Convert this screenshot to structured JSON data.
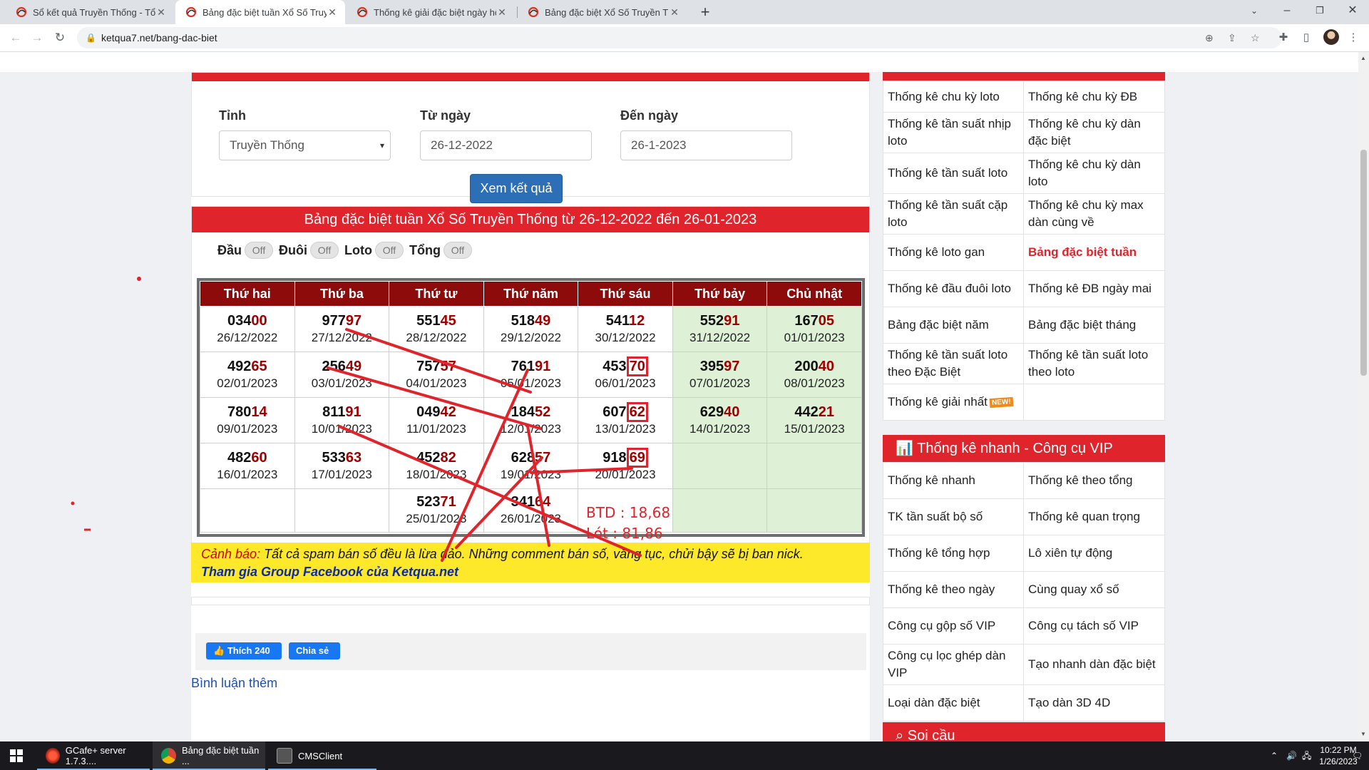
{
  "browser": {
    "tabs": [
      {
        "title": "Sổ kết quả Truyền Thống - Tổng",
        "active": false
      },
      {
        "title": "Bảng đặc biệt tuần Xổ Số Truyền",
        "active": true
      },
      {
        "title": "Thống kê giải đặc biệt ngày hôm",
        "active": false
      },
      {
        "title": "Bảng đặc biệt Xổ Số Truyền Thốn",
        "active": false
      }
    ],
    "url": "ketqua7.net/bang-dac-biet"
  },
  "form": {
    "tinh_label": "Tỉnh",
    "tinh_value": "Truyền Thống",
    "tu_ngay_label": "Từ ngày",
    "tu_ngay_value": "26-12-2022",
    "den_ngay_label": "Đến ngày",
    "den_ngay_value": "26-1-2023",
    "submit_label": "Xem kết quả"
  },
  "results": {
    "title": "Bảng đặc biệt tuần Xổ Số Truyền Thống từ 26-12-2022 đến 26-01-2023",
    "toggles": [
      {
        "label": "Đầu",
        "state": "Off"
      },
      {
        "label": "Đuôi",
        "state": "Off"
      },
      {
        "label": "Loto",
        "state": "Off"
      },
      {
        "label": "Tổng",
        "state": "Off"
      }
    ],
    "headers": [
      "Thứ hai",
      "Thứ ba",
      "Thứ tư",
      "Thứ năm",
      "Thứ sáu",
      "Thứ bảy",
      "Chủ nhật"
    ],
    "rows": [
      [
        {
          "head": "034",
          "tail": "00",
          "date": "26/12/2022"
        },
        {
          "head": "977",
          "tail": "97",
          "date": "27/12/2022"
        },
        {
          "head": "551",
          "tail": "45",
          "date": "28/12/2022"
        },
        {
          "head": "518",
          "tail": "49",
          "date": "29/12/2022"
        },
        {
          "head": "541",
          "tail": "12",
          "date": "30/12/2022"
        },
        {
          "head": "552",
          "tail": "91",
          "date": "31/12/2022"
        },
        {
          "head": "167",
          "tail": "05",
          "date": "01/01/2023"
        }
      ],
      [
        {
          "head": "492",
          "tail": "65",
          "date": "02/01/2023"
        },
        {
          "head": "256",
          "tail": "49",
          "date": "03/01/2023"
        },
        {
          "head": "757",
          "tail": "57",
          "date": "04/01/2023"
        },
        {
          "head": "761",
          "tail": "91",
          "date": "05/01/2023"
        },
        {
          "head": "453",
          "tail": "70",
          "date": "06/01/2023"
        },
        {
          "head": "395",
          "tail": "97",
          "date": "07/01/2023"
        },
        {
          "head": "200",
          "tail": "40",
          "date": "08/01/2023"
        }
      ],
      [
        {
          "head": "780",
          "tail": "14",
          "date": "09/01/2023"
        },
        {
          "head": "811",
          "tail": "91",
          "date": "10/01/2023"
        },
        {
          "head": "049",
          "tail": "42",
          "date": "11/01/2023"
        },
        {
          "head": "184",
          "tail": "52",
          "date": "12/01/2023"
        },
        {
          "head": "607",
          "tail": "62",
          "date": "13/01/2023"
        },
        {
          "head": "629",
          "tail": "40",
          "date": "14/01/2023"
        },
        {
          "head": "442",
          "tail": "21",
          "date": "15/01/2023"
        }
      ],
      [
        {
          "head": "482",
          "tail": "60",
          "date": "16/01/2023"
        },
        {
          "head": "533",
          "tail": "63",
          "date": "17/01/2023"
        },
        {
          "head": "452",
          "tail": "82",
          "date": "18/01/2023"
        },
        {
          "head": "628",
          "tail": "57",
          "date": "19/01/2023"
        },
        {
          "head": "918",
          "tail": "69",
          "date": "20/01/2023"
        },
        null,
        null
      ],
      [
        null,
        null,
        {
          "head": "523",
          "tail": "71",
          "date": "25/01/2023"
        },
        {
          "head": "341",
          "tail": "64",
          "date": "26/01/2023"
        },
        null,
        null,
        null
      ]
    ],
    "annotation_btd": "BTD : 18,68",
    "annotation_lot": "Lót :   81,86"
  },
  "social": {
    "like_label": "Thích 240",
    "share_label": "Chia sẻ"
  },
  "warning": {
    "label": "Cảnh báo:",
    "text": "Tất cả spam bán số đều là lừa đảo. Những comment bán số, văng tục, chửi bậy sẽ bị ban nick.",
    "link": "Tham gia Group Facebook của Ketqua.net"
  },
  "comment_more": "Bình luận thêm",
  "sidebar": {
    "stats": [
      [
        "Thống kê chu kỳ loto",
        "Thống kê chu kỳ ĐB"
      ],
      [
        "Thống kê tần suất nhịp loto",
        "Thống kê chu kỳ dàn đặc biệt"
      ],
      [
        "Thống kê tần suất loto",
        "Thống kê chu kỳ dàn loto"
      ],
      [
        "Thống kê tần suất cặp loto",
        "Thống kê chu kỳ max dàn cùng về"
      ],
      [
        "Thống kê loto gan",
        "Bảng đặc biệt tuần"
      ],
      [
        "Thống kê đầu đuôi loto",
        "Thống kê ĐB ngày mai"
      ],
      [
        "Bảng đặc biệt năm",
        "Bảng đặc biệt tháng"
      ],
      [
        "Thống kê tần suất loto theo Đặc Biệt",
        "Thống kê tần suất loto theo loto"
      ],
      [
        "Thống kê giải nhất",
        ""
      ]
    ],
    "new_badge": "NEW!",
    "vip_title": "Thống kê nhanh - Công cụ VIP",
    "vip": [
      [
        "Thống kê nhanh",
        "Thống kê theo tổng"
      ],
      [
        "TK tần suất bộ số",
        "Thống kê quan trọng"
      ],
      [
        "Thống kê tổng hợp",
        "Lô xiên tự động"
      ],
      [
        "Thống kê theo ngày",
        "Cùng quay xổ số"
      ],
      [
        "Công cụ gộp số VIP",
        "Công cụ tách số VIP"
      ],
      [
        "Công cụ lọc ghép dàn VIP",
        "Tạo nhanh dàn đặc biệt"
      ],
      [
        "Loại dàn đặc biệt",
        "Tạo dàn 3D 4D"
      ]
    ],
    "soi_cau_title": "Soi cầu"
  },
  "taskbar": {
    "items": [
      "GCafe+ server 1.7.3....",
      "Bảng đặc biệt tuần ...",
      "CMSClient"
    ],
    "time": "10:22 PM",
    "date": "1/26/2023"
  },
  "colors": {
    "accent_red": "#e0242b",
    "header_maroon": "#8e0b0b",
    "weekend_green": "#def0d6",
    "button_blue": "#2c6fb6",
    "warning_yellow": "#fde92a"
  }
}
